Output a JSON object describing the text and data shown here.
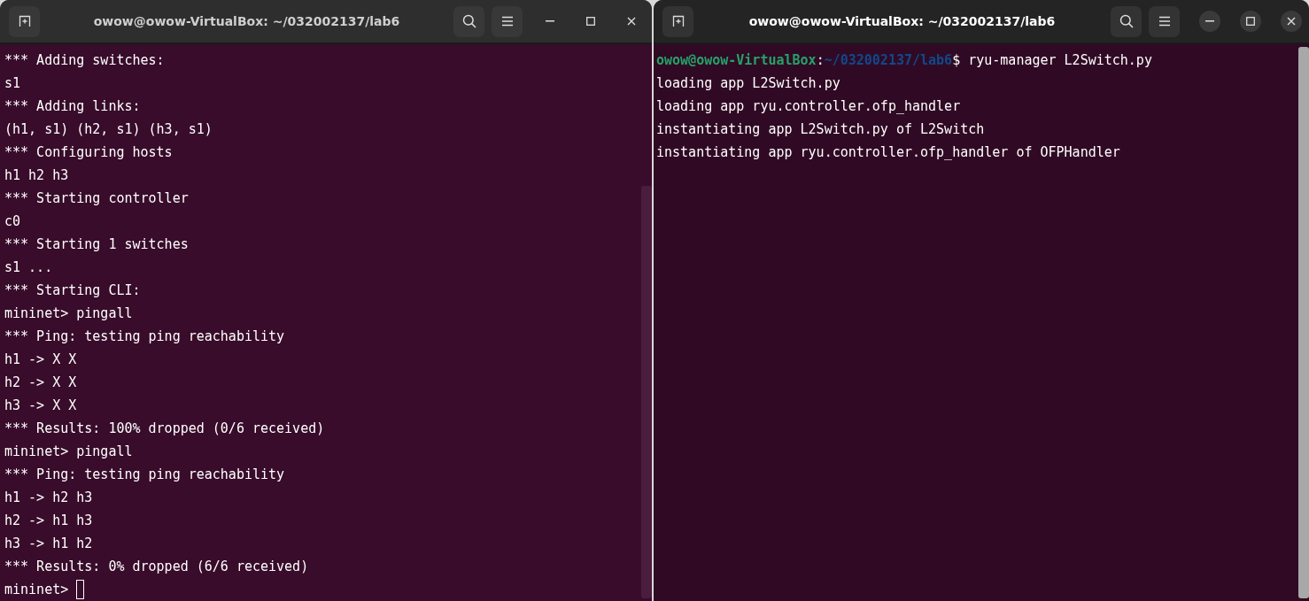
{
  "windows": [
    {
      "title": "owow@owow-VirtualBox: ~/032002137/lab6",
      "focused": false,
      "cursor": true,
      "lines": [
        [
          {
            "kind": "plain",
            "text": "*** Adding switches:"
          }
        ],
        [
          {
            "kind": "plain",
            "text": "s1"
          }
        ],
        [
          {
            "kind": "plain",
            "text": "*** Adding links:"
          }
        ],
        [
          {
            "kind": "plain",
            "text": "(h1, s1) (h2, s1) (h3, s1)"
          }
        ],
        [
          {
            "kind": "plain",
            "text": "*** Configuring hosts"
          }
        ],
        [
          {
            "kind": "plain",
            "text": "h1 h2 h3"
          }
        ],
        [
          {
            "kind": "plain",
            "text": "*** Starting controller"
          }
        ],
        [
          {
            "kind": "plain",
            "text": "c0"
          }
        ],
        [
          {
            "kind": "plain",
            "text": "*** Starting 1 switches"
          }
        ],
        [
          {
            "kind": "plain",
            "text": "s1 ..."
          }
        ],
        [
          {
            "kind": "plain",
            "text": "*** Starting CLI:"
          }
        ],
        [
          {
            "kind": "plain",
            "text": "mininet> pingall"
          }
        ],
        [
          {
            "kind": "plain",
            "text": "*** Ping: testing ping reachability"
          }
        ],
        [
          {
            "kind": "plain",
            "text": "h1 -> X X"
          }
        ],
        [
          {
            "kind": "plain",
            "text": "h2 -> X X"
          }
        ],
        [
          {
            "kind": "plain",
            "text": "h3 -> X X"
          }
        ],
        [
          {
            "kind": "plain",
            "text": "*** Results: 100% dropped (0/6 received)"
          }
        ],
        [
          {
            "kind": "plain",
            "text": "mininet> pingall"
          }
        ],
        [
          {
            "kind": "plain",
            "text": "*** Ping: testing ping reachability"
          }
        ],
        [
          {
            "kind": "plain",
            "text": "h1 -> h2 h3"
          }
        ],
        [
          {
            "kind": "plain",
            "text": "h2 -> h1 h3"
          }
        ],
        [
          {
            "kind": "plain",
            "text": "h3 -> h1 h2"
          }
        ],
        [
          {
            "kind": "plain",
            "text": "*** Results: 0% dropped (6/6 received)"
          }
        ],
        [
          {
            "kind": "plain",
            "text": "mininet> "
          }
        ]
      ]
    },
    {
      "title": "owow@owow-VirtualBox: ~/032002137/lab6",
      "focused": true,
      "cursor": false,
      "lines": [
        [
          {
            "kind": "user",
            "text": "owow@owow-VirtualBox"
          },
          {
            "kind": "plain",
            "text": ":"
          },
          {
            "kind": "path",
            "text": "~/032002137/lab6"
          },
          {
            "kind": "plain",
            "text": "$ ryu-manager L2Switch.py"
          }
        ],
        [
          {
            "kind": "plain",
            "text": "loading app L2Switch.py"
          }
        ],
        [
          {
            "kind": "plain",
            "text": "loading app ryu.controller.ofp_handler"
          }
        ],
        [
          {
            "kind": "plain",
            "text": "instantiating app L2Switch.py of L2Switch"
          }
        ],
        [
          {
            "kind": "plain",
            "text": "instantiating app ryu.controller.ofp_handler of OFPHandler"
          }
        ]
      ]
    }
  ]
}
